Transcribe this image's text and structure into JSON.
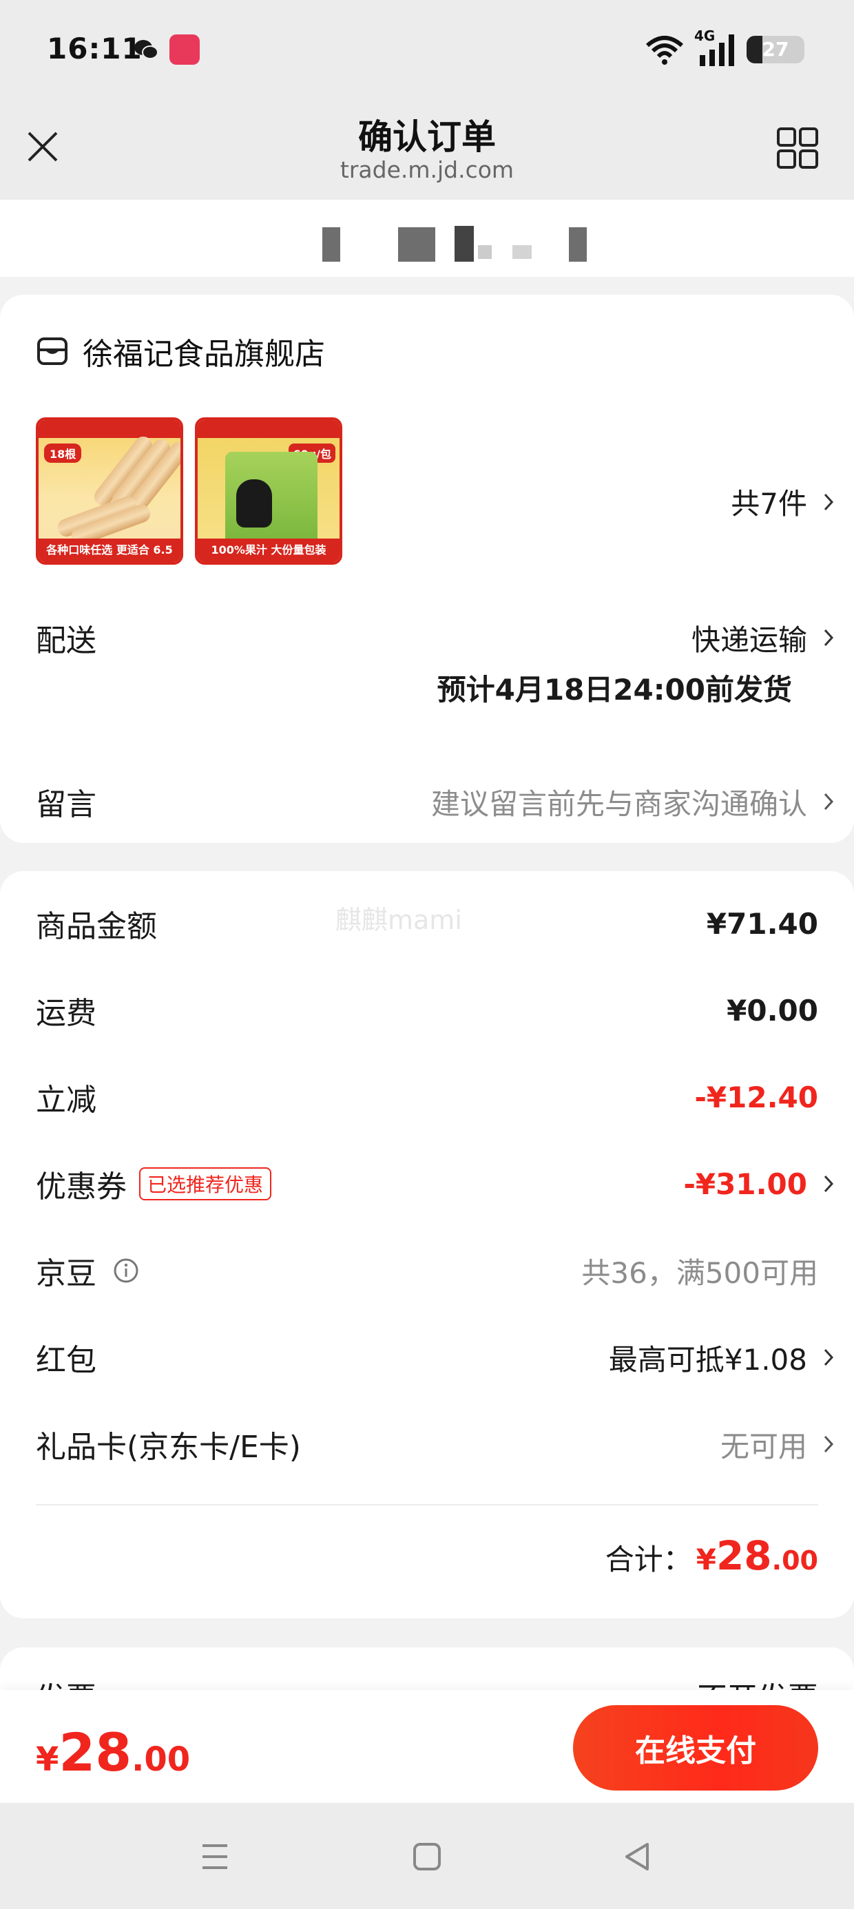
{
  "status_bar": {
    "time": "16:11",
    "network": "4G",
    "battery_percent": "27",
    "icons": [
      "wechat-icon",
      "app-notification-icon",
      "wifi-icon",
      "signal-icon",
      "battery-icon"
    ]
  },
  "title_bar": {
    "title": "确认订单",
    "subtitle": "trade.m.jd.com",
    "close_icon": "close-icon",
    "menu_icon": "grid-menu-icon"
  },
  "order": {
    "shop": {
      "icon": "store-icon",
      "name": "徐福记食品旗舰店"
    },
    "products": [
      {
        "name": "sausage-pack",
        "corner_text": "18根",
        "foot_text": "各种口味任选 更适合 6.5"
      },
      {
        "name": "juice-jelly-pack",
        "corner_text": "60g/包",
        "foot_text": "100%果汁 大份量包装"
      }
    ],
    "item_count": "共7件",
    "delivery": {
      "label": "配送",
      "method": "快递运输",
      "estimate": "预计4月18日24:00前发货"
    },
    "message": {
      "label": "留言",
      "placeholder": "建议留言前先与商家沟通确认"
    }
  },
  "summary": {
    "watermark": "麒麒mami",
    "goods_amount": {
      "label": "商品金额",
      "value": "¥71.40"
    },
    "shipping": {
      "label": "运费",
      "value": "¥0.00"
    },
    "instant_discount": {
      "label": "立减",
      "value": "-¥12.40"
    },
    "coupon": {
      "label": "优惠券",
      "tag": "已选推荐优惠",
      "value": "-¥31.00"
    },
    "jd_beans": {
      "label": "京豆",
      "value": "共36，满500可用"
    },
    "red_packet": {
      "label": "红包",
      "value": "最高可抵¥1.08"
    },
    "gift_card": {
      "label": "礼品卡(京东卡/E卡)",
      "value": "无可用"
    },
    "total": {
      "label": "合计：",
      "yen": "¥",
      "int": "28",
      "dec": ".00"
    }
  },
  "peek_row": {
    "left": "发票",
    "right": "不开发票"
  },
  "pay_bar": {
    "price_yen": "¥",
    "price_int": "28",
    "price_dec": ".00",
    "pay_button": "在线支付"
  },
  "nav_bar": {
    "icons": [
      "menu-icon",
      "home-icon",
      "back-icon"
    ]
  },
  "colors": {
    "accent": "#f0261e",
    "background": "#f2f2f2",
    "muted_text": "#8c8c8c"
  }
}
